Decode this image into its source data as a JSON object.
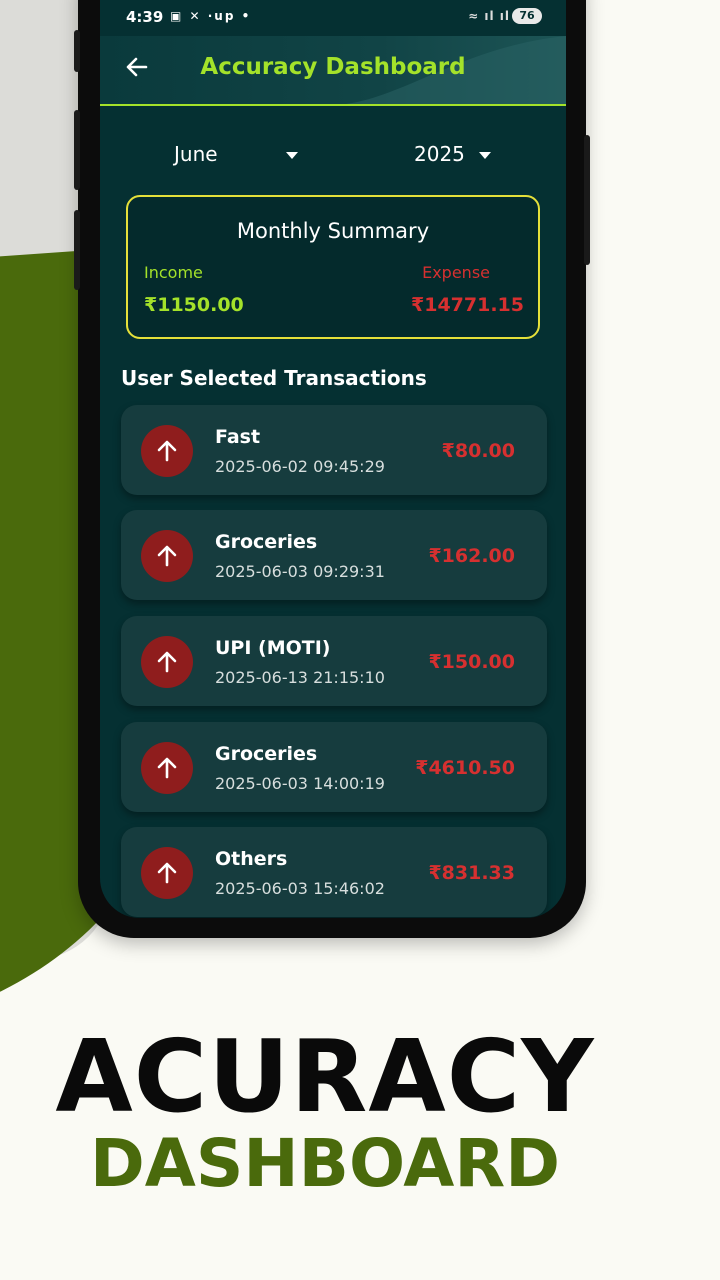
{
  "status_bar": {
    "time": "4:39",
    "left_icons": "▣ ✕ ·up •",
    "right_icons": "≈ ıl ıl",
    "battery": "76"
  },
  "app_bar": {
    "title": "Accuracy Dashboard"
  },
  "filters": {
    "month": "June",
    "year": "2025"
  },
  "summary": {
    "title": "Monthly Summary",
    "income_label": "Income",
    "income_value": "₹1150.00",
    "expense_label": "Expense",
    "expense_value": "₹14771.15"
  },
  "section_title": "User Selected Transactions",
  "transactions": [
    {
      "name": "Fast",
      "datetime": "2025-06-02 09:45:29",
      "amount": "₹80.00"
    },
    {
      "name": "Groceries",
      "datetime": "2025-06-03 09:29:31",
      "amount": "₹162.00"
    },
    {
      "name": "UPI (MOTI)",
      "datetime": "2025-06-13 21:15:10",
      "amount": "₹150.00"
    },
    {
      "name": "Groceries",
      "datetime": "2025-06-03 14:00:19",
      "amount": "₹4610.50"
    },
    {
      "name": "Others",
      "datetime": "2025-06-03 15:46:02",
      "amount": "₹831.33"
    }
  ],
  "headline": {
    "line1": "ACURACY",
    "line2": "DASHBOARD"
  },
  "colors": {
    "accent_green": "#a4e22a",
    "expense_red": "#d63030",
    "screen_bg": "#053032",
    "brand_olive": "#4a6a0c"
  }
}
